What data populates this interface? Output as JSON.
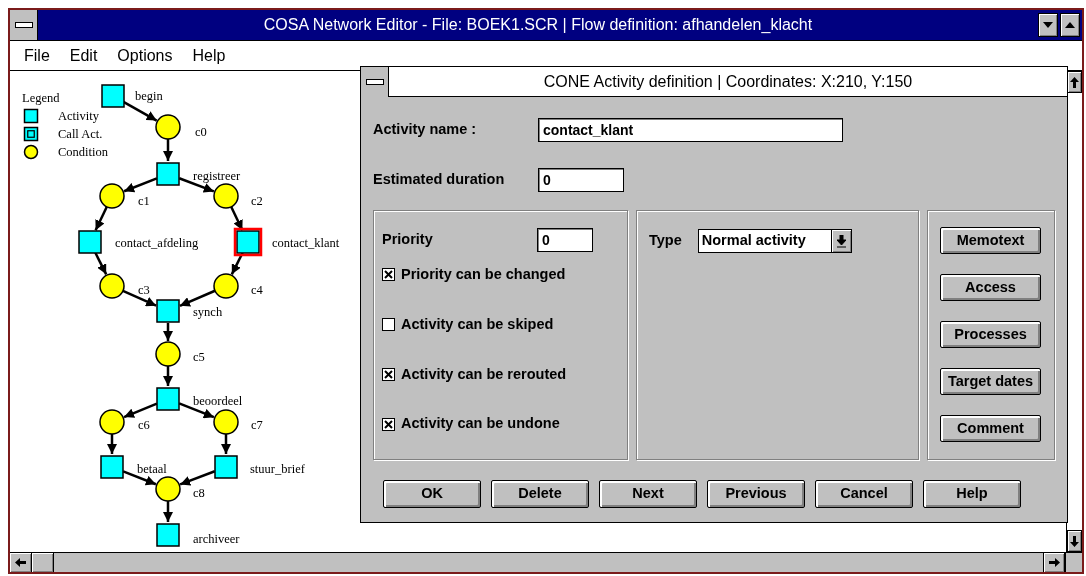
{
  "window": {
    "title": "COSA Network Editor - File: BOEK1.SCR | Flow definition: afhandelen_klacht"
  },
  "menu": [
    {
      "label": "File"
    },
    {
      "label": "Edit"
    },
    {
      "label": "Options"
    },
    {
      "label": "Help"
    }
  ],
  "diagram": {
    "legend": {
      "title": "Legend",
      "items": [
        {
          "kind": "activity",
          "label": "Activity"
        },
        {
          "kind": "call",
          "label": "Call Act."
        },
        {
          "kind": "condition",
          "label": "Condition"
        }
      ]
    },
    "nodes": [
      {
        "kind": "activity",
        "label": "begin",
        "selected": false
      },
      {
        "kind": "condition",
        "label": "c0",
        "selected": false
      },
      {
        "kind": "activity",
        "label": "registreer",
        "selected": false
      },
      {
        "kind": "condition",
        "label": "c1",
        "selected": false
      },
      {
        "kind": "condition",
        "label": "c2",
        "selected": false
      },
      {
        "kind": "activity",
        "label": "contact_afdeling",
        "selected": false
      },
      {
        "kind": "activity",
        "label": "contact_klant",
        "selected": true
      },
      {
        "kind": "condition",
        "label": "c3",
        "selected": false
      },
      {
        "kind": "condition",
        "label": "c4",
        "selected": false
      },
      {
        "kind": "activity",
        "label": "synch",
        "selected": false
      },
      {
        "kind": "condition",
        "label": "c5",
        "selected": false
      },
      {
        "kind": "activity",
        "label": "beoordeel",
        "selected": false
      },
      {
        "kind": "condition",
        "label": "c6",
        "selected": false
      },
      {
        "kind": "condition",
        "label": "c7",
        "selected": false
      },
      {
        "kind": "activity",
        "label": "betaal",
        "selected": false
      },
      {
        "kind": "activity",
        "label": "stuur_brief",
        "selected": false
      },
      {
        "kind": "condition",
        "label": "c8",
        "selected": false
      },
      {
        "kind": "activity",
        "label": "archiveer",
        "selected": false
      }
    ]
  },
  "dialog": {
    "title": "CONE Activity definition | Coordinates: X:210, Y:150",
    "fields": [
      {
        "label": "Activity name :",
        "value": "contact_klant"
      },
      {
        "label": "Estimated duration",
        "value": "0"
      }
    ],
    "priority": {
      "label": "Priority",
      "value": "0"
    },
    "checkboxes": [
      {
        "label": "Priority can be changed",
        "checked": true
      },
      {
        "label": "Activity can be skiped",
        "checked": false
      },
      {
        "label": "Activity can be rerouted",
        "checked": true
      },
      {
        "label": "Activity can be undone",
        "checked": true
      }
    ],
    "type": {
      "label": "Type",
      "value": "Normal activity"
    },
    "side_buttons": [
      {
        "label": "Memotext"
      },
      {
        "label": "Access"
      },
      {
        "label": "Processes"
      },
      {
        "label": "Target dates"
      },
      {
        "label": "Comment"
      }
    ],
    "buttons": [
      {
        "label": "OK"
      },
      {
        "label": "Delete"
      },
      {
        "label": "Next"
      },
      {
        "label": "Previous"
      },
      {
        "label": "Cancel"
      },
      {
        "label": "Help"
      }
    ]
  }
}
